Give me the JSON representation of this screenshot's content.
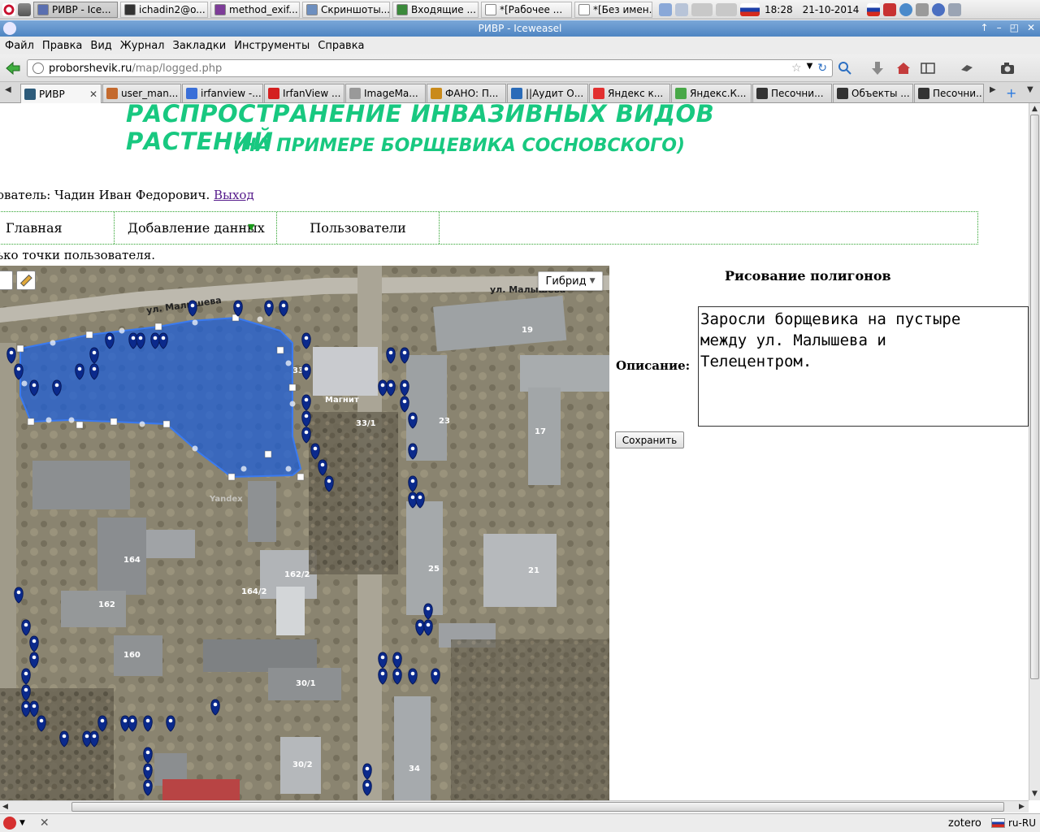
{
  "system_panel": {
    "tasks": [
      {
        "label": "РИВР - Ice...",
        "icon": "iceweasel-icon",
        "color": "#5a6fb0",
        "active": true
      },
      {
        "label": "ichadin2@o...",
        "icon": "terminal-icon",
        "color": "#333333",
        "active": false
      },
      {
        "label": "method_exif...",
        "icon": "emacs-icon",
        "color": "#7d3c98",
        "active": false
      },
      {
        "label": "Скриншоты...",
        "icon": "folder-icon",
        "color": "#6d8fbf",
        "active": false
      },
      {
        "label": "Входящие ...",
        "icon": "mail-icon",
        "color": "#3b8a3b",
        "active": false
      },
      {
        "label": "*[Рабочее ...",
        "icon": "document-icon",
        "color": "#ffffff",
        "active": false
      },
      {
        "label": "*[Без имен...",
        "icon": "document-icon",
        "color": "#ffffff",
        "active": false
      }
    ],
    "clock_time": "18:28",
    "clock_date": "21-10-2014"
  },
  "window": {
    "title": "РИВР - Iceweasel"
  },
  "menubar": {
    "items": [
      "Файл",
      "Правка",
      "Вид",
      "Журнал",
      "Закладки",
      "Инструменты",
      "Справка"
    ]
  },
  "navbar": {
    "url_host": "proborshevik.ru",
    "url_path": "/map/logged.php"
  },
  "tabs": [
    {
      "label": "РИВР",
      "icon": "page-icon",
      "color": "#2d5b7a",
      "active": true
    },
    {
      "label": "user_man...",
      "icon": "edit-icon",
      "color": "#c46a2e",
      "active": false
    },
    {
      "label": "irfanview -...",
      "icon": "google-icon",
      "color": "#3a6fd8",
      "active": false
    },
    {
      "label": "IrfanView ...",
      "icon": "irfanview-icon",
      "color": "#d42020",
      "active": false
    },
    {
      "label": "ImageMa...",
      "icon": "pen-icon",
      "color": "#999999",
      "active": false
    },
    {
      "label": "ФАНО: П...",
      "icon": "fano-icon",
      "color": "#c98a1a",
      "active": false
    },
    {
      "label": "||Аудит О...",
      "icon": "audit-icon",
      "color": "#2a6bb8",
      "active": false
    },
    {
      "label": "Яндекс к...",
      "icon": "yandex-icon",
      "color": "#e23030",
      "active": false
    },
    {
      "label": "Яндекс.К...",
      "icon": "yandex-money-icon",
      "color": "#48a848",
      "active": false
    },
    {
      "label": "Песочни...",
      "icon": "sandbox-icon",
      "color": "#333333",
      "active": false
    },
    {
      "label": "Объекты ...",
      "icon": "sandbox-icon",
      "color": "#333333",
      "active": false
    },
    {
      "label": "Песочни...",
      "icon": "sandbox-icon",
      "color": "#333333",
      "active": false
    }
  ],
  "page": {
    "title_line1": "РАСПРОСТРАНЕНИЕ ИНВАЗИВНЫХ ВИДОВ РАСТЕНИЙ",
    "title_line2": "(НА ПРИМЕРЕ БОРЩЕВИКА СОСНОВСКОГО)",
    "user_prefix": "ователь: Чадин Иван Федорович. ",
    "logout_link": "Выход",
    "nav": [
      "Главная",
      "Добавление данных",
      "Пользователи"
    ],
    "hint": "ько точки пользователя.",
    "map_type": "Гибрид",
    "map_street_1": "ул. Малышева",
    "map_street_2": "ул. Малышева",
    "map_labels": [
      "19",
      "33",
      "Магнит",
      "33/1",
      "23",
      "17",
      "164",
      "162/2",
      "164/2",
      "162",
      "25",
      "21",
      "160",
      "30/1",
      "30/2",
      "34",
      "Yandex"
    ],
    "poly_heading": "Рисование полигонов",
    "desc_label": "Описание:",
    "desc_text": "Заросли борщевика на пустыре\nмежду ул. Малышева и\nТелецентром.",
    "save_label": "Сохранить"
  },
  "statusbar": {
    "zotero": "zotero",
    "locale": "ru-RU"
  },
  "colors": {
    "title_green": "#18c880",
    "polygon_blue": "#1f5fd6",
    "marker_blue": "#0b2a8c"
  }
}
